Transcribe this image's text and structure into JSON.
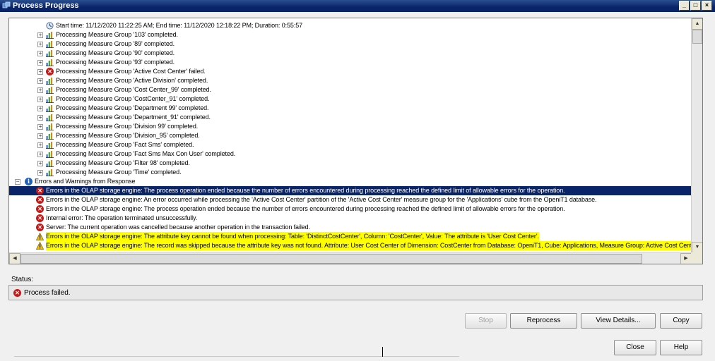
{
  "window": {
    "title": "Process Progress"
  },
  "tree": {
    "rows": [
      {
        "icon": "clock-icon",
        "text": "Start time: 11/12/2020 11:22:25 AM; End time: 11/12/2020 12:18:22 PM; Duration: 0:55:57",
        "indent": 2,
        "expand": false,
        "highlight": false,
        "selected": false
      },
      {
        "icon": "chart-icon",
        "text": "Processing Measure Group '103' completed.",
        "indent": 2,
        "expand": true,
        "highlight": false,
        "selected": false
      },
      {
        "icon": "chart-icon",
        "text": "Processing Measure Group '89' completed.",
        "indent": 2,
        "expand": true,
        "highlight": false,
        "selected": false
      },
      {
        "icon": "chart-icon",
        "text": "Processing Measure Group '90' completed.",
        "indent": 2,
        "expand": true,
        "highlight": false,
        "selected": false
      },
      {
        "icon": "chart-icon",
        "text": "Processing Measure Group '93' completed.",
        "indent": 2,
        "expand": true,
        "highlight": false,
        "selected": false
      },
      {
        "icon": "error-icon",
        "text": "Processing Measure Group 'Active Cost Center' failed.",
        "indent": 2,
        "expand": true,
        "highlight": false,
        "selected": false
      },
      {
        "icon": "chart-icon",
        "text": "Processing Measure Group 'Active Division' completed.",
        "indent": 2,
        "expand": true,
        "highlight": false,
        "selected": false
      },
      {
        "icon": "chart-icon",
        "text": "Processing Measure Group 'Cost Center_99' completed.",
        "indent": 2,
        "expand": true,
        "highlight": false,
        "selected": false
      },
      {
        "icon": "chart-icon",
        "text": "Processing Measure Group 'CostCenter_91' completed.",
        "indent": 2,
        "expand": true,
        "highlight": false,
        "selected": false
      },
      {
        "icon": "chart-icon",
        "text": "Processing Measure Group 'Department 99' completed.",
        "indent": 2,
        "expand": true,
        "highlight": false,
        "selected": false
      },
      {
        "icon": "chart-icon",
        "text": "Processing Measure Group 'Department_91' completed.",
        "indent": 2,
        "expand": true,
        "highlight": false,
        "selected": false
      },
      {
        "icon": "chart-icon",
        "text": "Processing Measure Group 'Division 99' completed.",
        "indent": 2,
        "expand": true,
        "highlight": false,
        "selected": false
      },
      {
        "icon": "chart-icon",
        "text": "Processing Measure Group 'Division_95' completed.",
        "indent": 2,
        "expand": true,
        "highlight": false,
        "selected": false
      },
      {
        "icon": "chart-icon",
        "text": "Processing Measure Group 'Fact Sms' completed.",
        "indent": 2,
        "expand": true,
        "highlight": false,
        "selected": false
      },
      {
        "icon": "chart-icon",
        "text": "Processing Measure Group 'Fact Sms Max Con User' completed.",
        "indent": 2,
        "expand": true,
        "highlight": false,
        "selected": false
      },
      {
        "icon": "chart-icon",
        "text": "Processing Measure Group 'Filter 98' completed.",
        "indent": 2,
        "expand": true,
        "highlight": false,
        "selected": false
      },
      {
        "icon": "chart-icon",
        "text": "Processing Measure Group 'Time' completed.",
        "indent": 2,
        "expand": true,
        "highlight": false,
        "selected": false
      },
      {
        "icon": "info-icon",
        "text": "Errors and Warnings from Response",
        "indent": 0,
        "expand": "minus",
        "highlight": false,
        "selected": false
      },
      {
        "icon": "error-icon",
        "text": "Errors in the OLAP storage engine: The process operation ended because the number of errors encountered during processing reached the defined limit of allowable errors for the operation.",
        "indent": 1,
        "expand": false,
        "highlight": false,
        "selected": true
      },
      {
        "icon": "error-icon",
        "text": "Errors in the OLAP storage engine: An error occurred while processing the 'Active Cost Center' partition of the 'Active Cost Center' measure group for the 'Applications' cube from the OpeniT1 database.",
        "indent": 1,
        "expand": false,
        "highlight": false,
        "selected": false
      },
      {
        "icon": "error-icon",
        "text": "Errors in the OLAP storage engine: The process operation ended because the number of errors encountered during processing reached the defined limit of allowable errors for the operation.",
        "indent": 1,
        "expand": false,
        "highlight": false,
        "selected": false
      },
      {
        "icon": "error-icon",
        "text": "Internal error: The operation terminated unsuccessfully.",
        "indent": 1,
        "expand": false,
        "highlight": false,
        "selected": false
      },
      {
        "icon": "error-icon",
        "text": "Server: The current operation was cancelled because another operation in the transaction failed.",
        "indent": 1,
        "expand": false,
        "highlight": false,
        "selected": false
      },
      {
        "icon": "warning-icon",
        "text": "Errors in the OLAP storage engine: The attribute key cannot be found when processing: Table: 'DistinctCostCenter', Column: 'CostCenter', Value:                                                                      The attribute is 'User Cost Center'.",
        "indent": 1,
        "expand": false,
        "highlight": true,
        "selected": false
      },
      {
        "icon": "warning-icon",
        "text": "Errors in the OLAP storage engine: The record was skipped because the attribute key was not found. Attribute: User Cost Center of Dimension: CostCenter from Database: OpeniT1, Cube: Applications, Measure Group: Active Cost Center",
        "indent": 1,
        "expand": false,
        "highlight": true,
        "selected": false
      }
    ]
  },
  "status": {
    "label": "Status:",
    "text": "Process failed."
  },
  "buttons": {
    "stop": "Stop",
    "reprocess": "Reprocess",
    "view_details": "View Details...",
    "copy": "Copy",
    "close": "Close",
    "help": "Help"
  },
  "colors": {
    "selection": "#0a246a",
    "highlight": "#ffff00",
    "error": "#c81818"
  }
}
